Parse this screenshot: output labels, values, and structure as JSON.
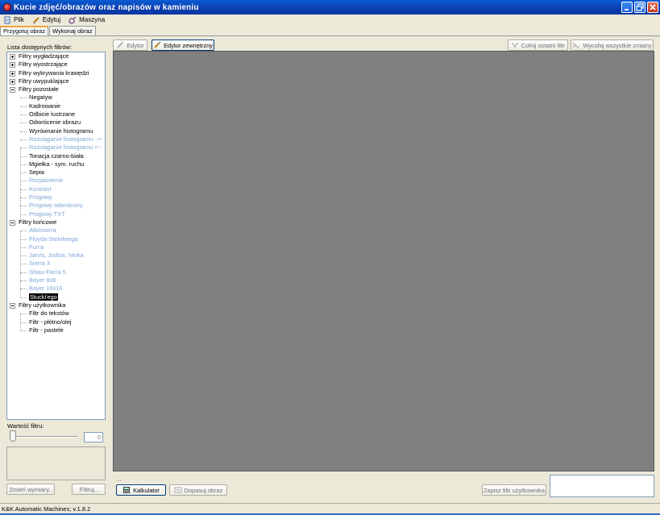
{
  "window": {
    "title": "Kucie zdjęć/obrazów oraz napisów w kamieniu"
  },
  "menu": {
    "items": [
      {
        "label": "Plik",
        "icon": "document-icon"
      },
      {
        "label": "Edytuj",
        "icon": "pencil-icon"
      },
      {
        "label": "Maszyna",
        "icon": "machine-icon"
      }
    ]
  },
  "tabs": [
    {
      "label": "Przygotuj obraz",
      "active": true
    },
    {
      "label": "Wykonaj obraz",
      "active": false
    }
  ],
  "filters_panel": {
    "list_label": "Lista dostępnych filtrów:",
    "tree": [
      {
        "label": "Filtry wygładzające",
        "level": 1,
        "type": "collapsed"
      },
      {
        "label": "Filtry wyostrzające",
        "level": 1,
        "type": "collapsed"
      },
      {
        "label": "Filtry wykrywania krawędzi",
        "level": 1,
        "type": "collapsed"
      },
      {
        "label": "Filtry uwypuklające",
        "level": 1,
        "type": "collapsed"
      },
      {
        "label": "Filtry pozostałe",
        "level": 1,
        "type": "expanded"
      },
      {
        "label": "Negatyw",
        "level": 2
      },
      {
        "label": "Kadrowanie",
        "level": 2
      },
      {
        "label": "Odbicie lustrzane",
        "level": 2
      },
      {
        "label": "Odwrócenie obrazu",
        "level": 2
      },
      {
        "label": "Wyrównanie histogramu",
        "level": 2
      },
      {
        "label": "Rozciąganie histogramu -->",
        "level": 2,
        "disabled": true
      },
      {
        "label": "Rozciąganie histogramu <--",
        "level": 2,
        "disabled": true
      },
      {
        "label": "Tonacja czarno-biała",
        "level": 2
      },
      {
        "label": "Mgiełka - sym. ruchu",
        "level": 2
      },
      {
        "label": "Sepia",
        "level": 2
      },
      {
        "label": "Rozjaśnienie",
        "level": 2,
        "disabled": true
      },
      {
        "label": "Kontrast",
        "level": 2,
        "disabled": true
      },
      {
        "label": "Progowy",
        "level": 2,
        "disabled": true
      },
      {
        "label": "Progowy odwrócony",
        "level": 2,
        "disabled": true
      },
      {
        "label": "Progowy TXT",
        "level": 2,
        "disabled": true
      },
      {
        "label": "Filtry końcowe",
        "level": 1,
        "type": "expanded"
      },
      {
        "label": "Atkinson'a",
        "level": 2,
        "disabled": true
      },
      {
        "label": "Floyda-Steinberga",
        "level": 2,
        "disabled": true
      },
      {
        "label": "Fun'a",
        "level": 2,
        "disabled": true
      },
      {
        "label": "Jarvis, Judice, Ninka",
        "level": 2,
        "disabled": true
      },
      {
        "label": "Sierra 3",
        "level": 2,
        "disabled": true
      },
      {
        "label": "Shiau-Fan'a 5",
        "level": 2,
        "disabled": true
      },
      {
        "label": "Bayer 8x8",
        "level": 2,
        "disabled": true
      },
      {
        "label": "Bayer 16x16",
        "level": 2,
        "disabled": true
      },
      {
        "label": "Stucki'ego",
        "level": 2,
        "selected": true
      },
      {
        "label": "Filtry użytkownika",
        "level": 1,
        "type": "expanded"
      },
      {
        "label": "Filtr do tekstów",
        "level": 2
      },
      {
        "label": "Filtr - płótno/olej",
        "level": 2
      },
      {
        "label": "Filtr - pastele",
        "level": 2
      }
    ],
    "value_label": "Wartość filtru:",
    "value": "0",
    "resize_button": "Zmień wymiary..",
    "filter_button": "Filtruj.."
  },
  "toolbar": {
    "editor_label": "Edytor",
    "external_editor_label": "Edytor zewnętrzny",
    "undo_last_label": "Cofnij ostatni filtr",
    "undo_all_label": "Wycofaj wszystkie zmiany"
  },
  "bottom": {
    "dots": "...",
    "calculator_label": "Kalkulator",
    "fit_image_label": "Dopasuj obraz",
    "save_filter_label": "Zapisz filtr użytkownika"
  },
  "status": {
    "text": "K&K Automatic Machines; v.1.8.2"
  },
  "colors": {
    "titlebar": "#0a3fb0",
    "canvas": "#808080",
    "disabled_item": "#7ea6d8",
    "selected_item_bg": "#000000"
  }
}
